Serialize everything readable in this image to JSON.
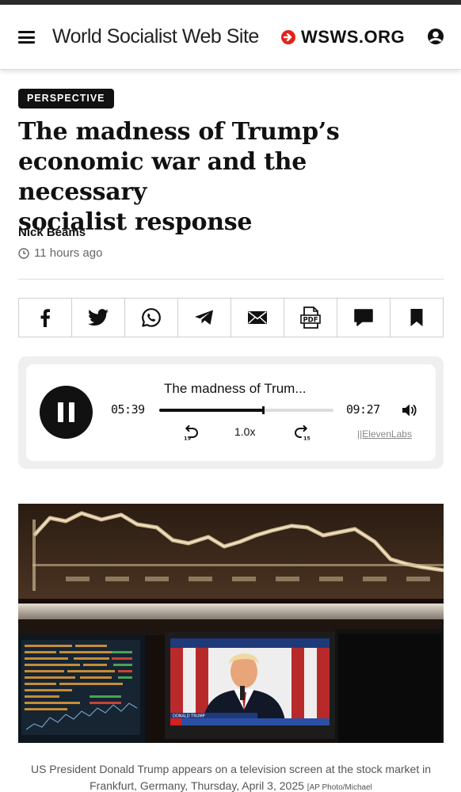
{
  "header": {
    "site_name": "World Socialist Web Site",
    "logo_text": "WSWS.ORG",
    "icons": [
      "hamburger-menu-icon",
      "wsws-logo-icon",
      "account-icon"
    ],
    "brand_color": "#e2231a"
  },
  "article": {
    "section_badge": "PERSPECTIVE",
    "headline_lines": [
      "The madness of Trump’s",
      "economic war and the necessary",
      "socialist response"
    ],
    "author": "Nick Beams",
    "time_ago": "11 hours ago"
  },
  "share_bar": {
    "icons": [
      "facebook-icon",
      "twitter-icon",
      "whatsapp-icon",
      "telegram-icon",
      "email-icon",
      "pdf-icon",
      "comment-icon",
      "bookmark-icon"
    ]
  },
  "audio_player": {
    "title": "The madness of Trum...",
    "elapsed": "05:39",
    "duration": "09:27",
    "progress_fraction": 0.597,
    "speed": "1.0x",
    "skip_back_label": "15",
    "skip_forward_label": "15",
    "credit": "||ElevenLabs",
    "state": "playing"
  },
  "image": {
    "caption_text": "US President Donald Trump appears on a television screen at the stock market in Frankfurt, Germany, Thursday, April 3, 2025",
    "caption_credit": "[AP Photo/Michael",
    "tv_lower_third": "DONALD TRUMP"
  }
}
